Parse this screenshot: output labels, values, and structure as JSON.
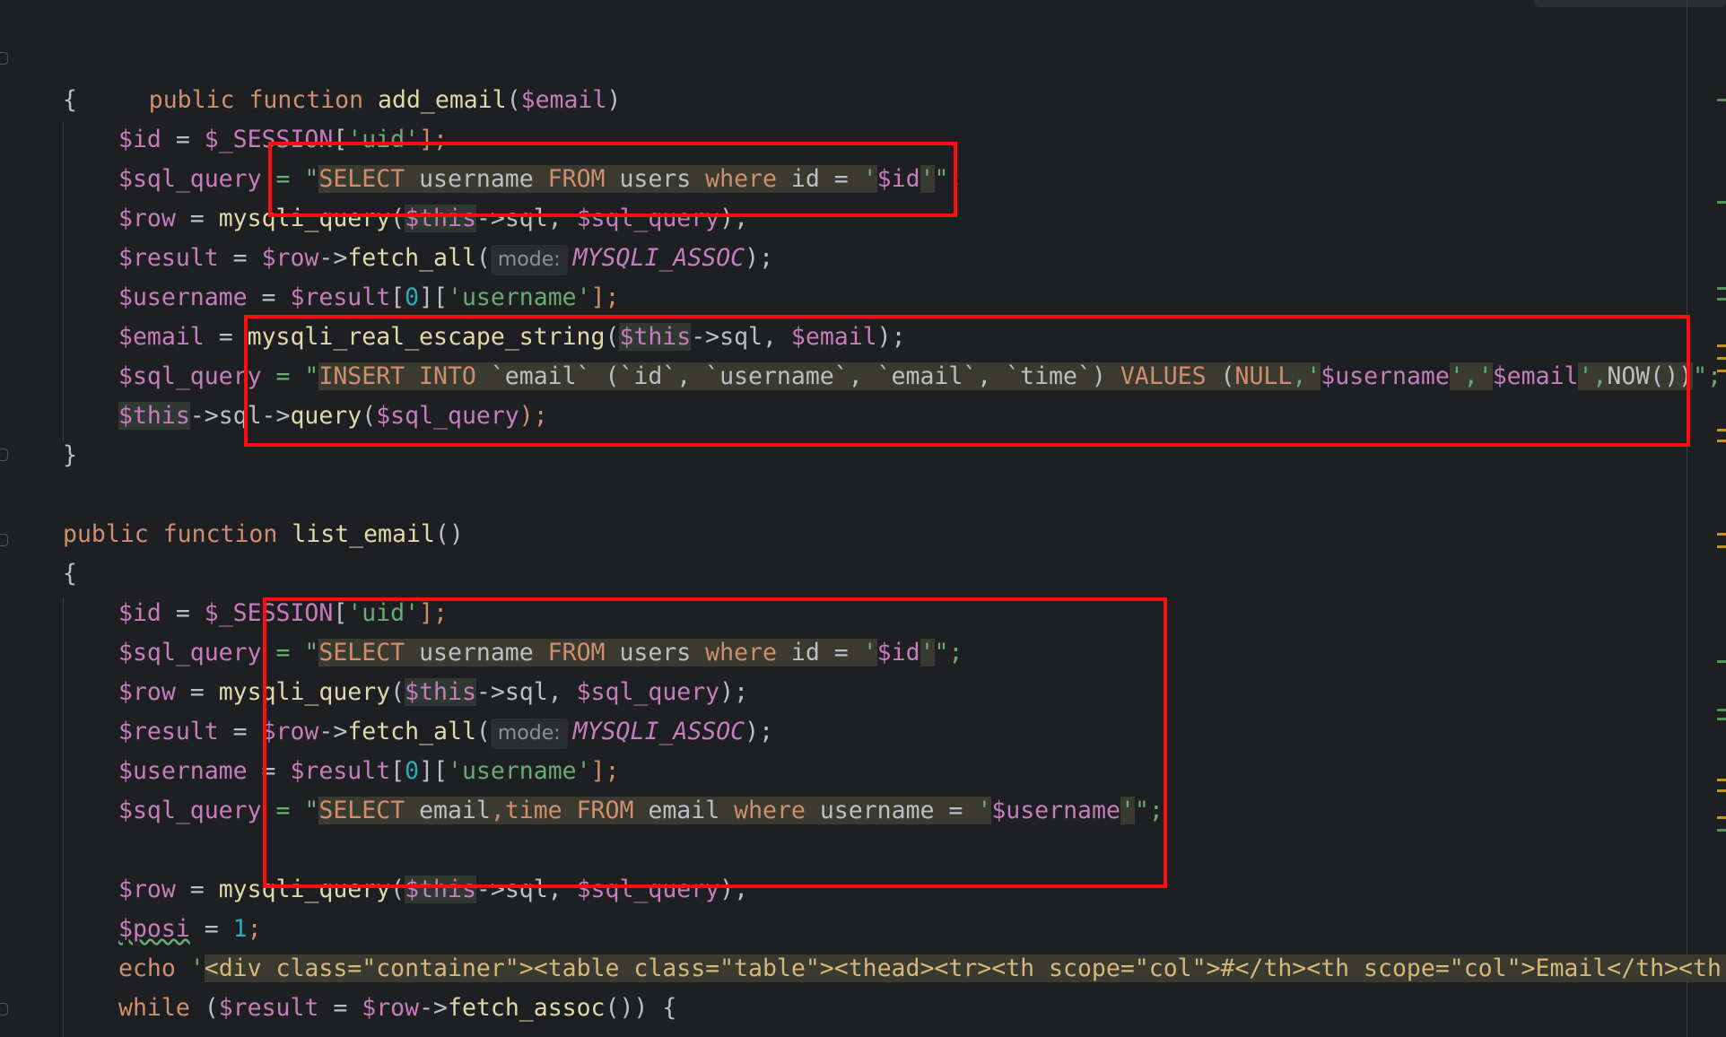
{
  "editor": {
    "functions": [
      {
        "signature": {
          "kw1": "public",
          "kw2": "function",
          "name": "add_email",
          "open": "(",
          "param": "$email",
          "close": ")"
        },
        "open_brace": "{",
        "close_brace": "}"
      },
      {
        "signature": {
          "kw1": "public",
          "kw2": "function",
          "name": "list_email",
          "open": "()",
          "param": "",
          "close": ""
        },
        "open_brace": "{"
      }
    ],
    "hint_mode": "mode:",
    "lines": {
      "a1": [
        "$id",
        " = ",
        "$_SESSION",
        "[",
        "'uid'",
        "];"
      ],
      "a2_pre": [
        "$sql_query",
        " = \""
      ],
      "a2_sql": [
        "SELECT",
        " username ",
        "FROM",
        " users ",
        "where",
        " id = ",
        "'",
        "$id",
        "'"
      ],
      "a2_post": "\";",
      "a3": [
        "$row",
        " = ",
        "mysqli_query",
        "(",
        "$this",
        "->sql, ",
        "$sql_query",
        ");"
      ],
      "a4": [
        "$result",
        " = ",
        "$row",
        "->",
        "fetch_all",
        "(",
        "MYSQLI_ASSOC",
        ");"
      ],
      "a5": [
        "$username",
        " = ",
        "$result",
        "[",
        "0",
        "][",
        "'username'",
        "];"
      ],
      "a6": [
        "$email",
        " = ",
        "mysqli_real_escape_string",
        "(",
        "$this",
        "->sql, ",
        "$email",
        ");"
      ],
      "a7_pre": [
        "$sql_query",
        " = \""
      ],
      "a7_sql": [
        "INSERT INTO",
        " `email` (`id`, `username`, `email`, `time`) ",
        "VALUES",
        " (",
        "NULL",
        ",'",
        "$username",
        "','",
        "$email",
        "',",
        "NOW",
        "())"
      ],
      "a7_post": "\";",
      "a8": [
        "$this",
        "->sql->",
        "query",
        "(",
        "$sql_query",
        ");"
      ],
      "b1": [
        "$id",
        " = ",
        "$_SESSION",
        "[",
        "'uid'",
        "];"
      ],
      "b2_pre": [
        "$sql_query",
        " = \""
      ],
      "b2_sql": [
        "SELECT",
        " username ",
        "FROM",
        " users ",
        "where",
        " id = ",
        "'",
        "$id",
        "'"
      ],
      "b2_post": "\";",
      "b3": [
        "$row",
        " = ",
        "mysqli_query",
        "(",
        "$this",
        "->sql, ",
        "$sql_query",
        ");"
      ],
      "b4": [
        "$result",
        " = ",
        "$row",
        "->",
        "fetch_all",
        "(",
        "MYSQLI_ASSOC",
        ");"
      ],
      "b5": [
        "$username",
        " = ",
        "$result",
        "[",
        "0",
        "][",
        "'username'",
        "];"
      ],
      "b6_pre": [
        "$sql_query",
        " = \""
      ],
      "b6_sql": [
        "SELECT",
        " email",
        ",",
        "time ",
        "FROM",
        " email ",
        "where",
        " username = ",
        "'",
        "$username",
        "'"
      ],
      "b6_post": "\";",
      "b7": [
        "$row",
        " = ",
        "mysqli_query",
        "(",
        "$this",
        "->sql, ",
        "$sql_query",
        ");"
      ],
      "b8": [
        "$posi",
        " = ",
        "1",
        ";"
      ],
      "b9": [
        "echo",
        " '",
        "<div class=\"container\"><table class=\"table\"><thead><tr><th scope=\"col\">#</th><th scope=\"col\">Email</th><th sc"
      ],
      "b10": [
        "while",
        " (",
        "$result",
        " = ",
        "$row",
        "->",
        "fetch_assoc",
        "()) {"
      ]
    }
  }
}
